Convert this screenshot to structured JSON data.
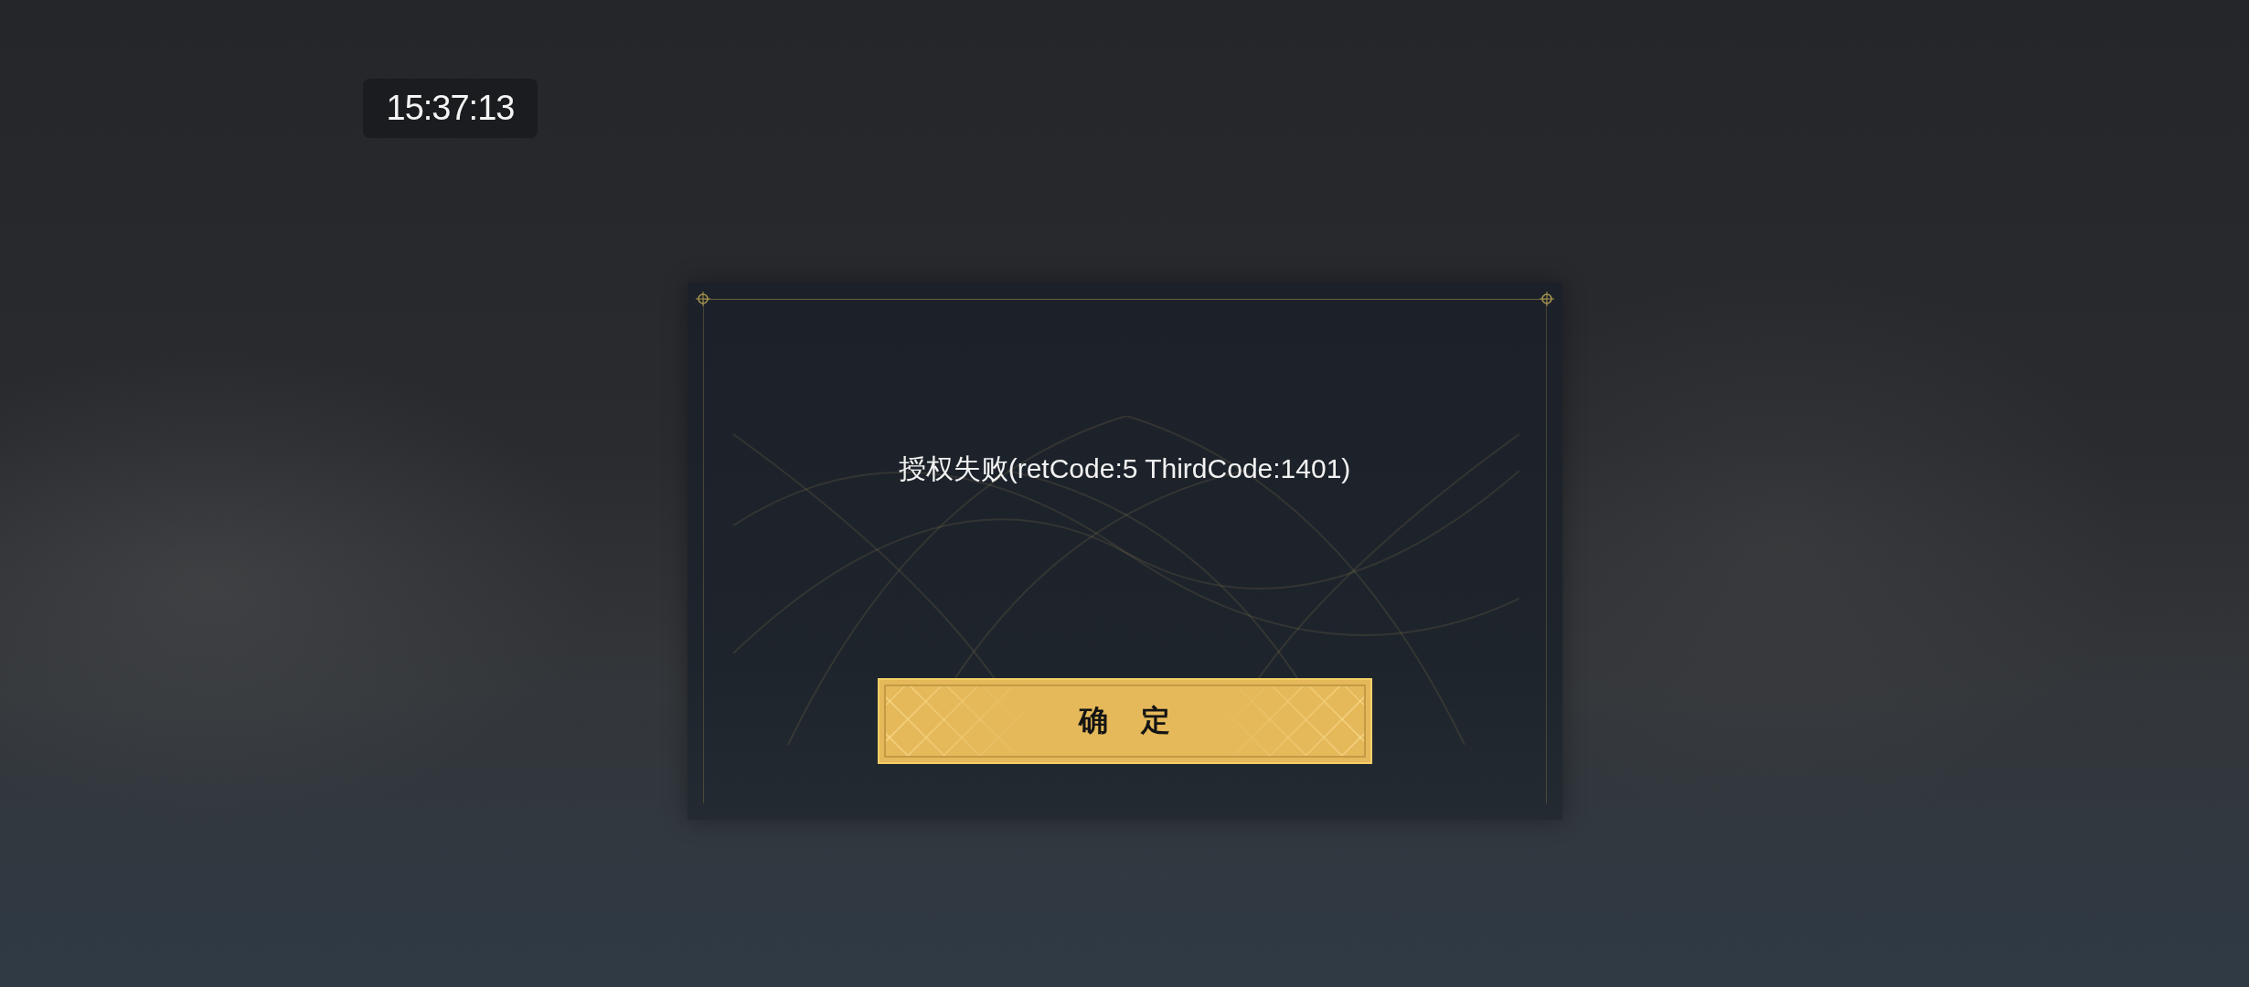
{
  "clock": {
    "time": "15:37:13"
  },
  "dialog": {
    "message": "授权失败(retCode:5 ThirdCode:1401)",
    "confirm_button": {
      "label": "确 定"
    }
  }
}
